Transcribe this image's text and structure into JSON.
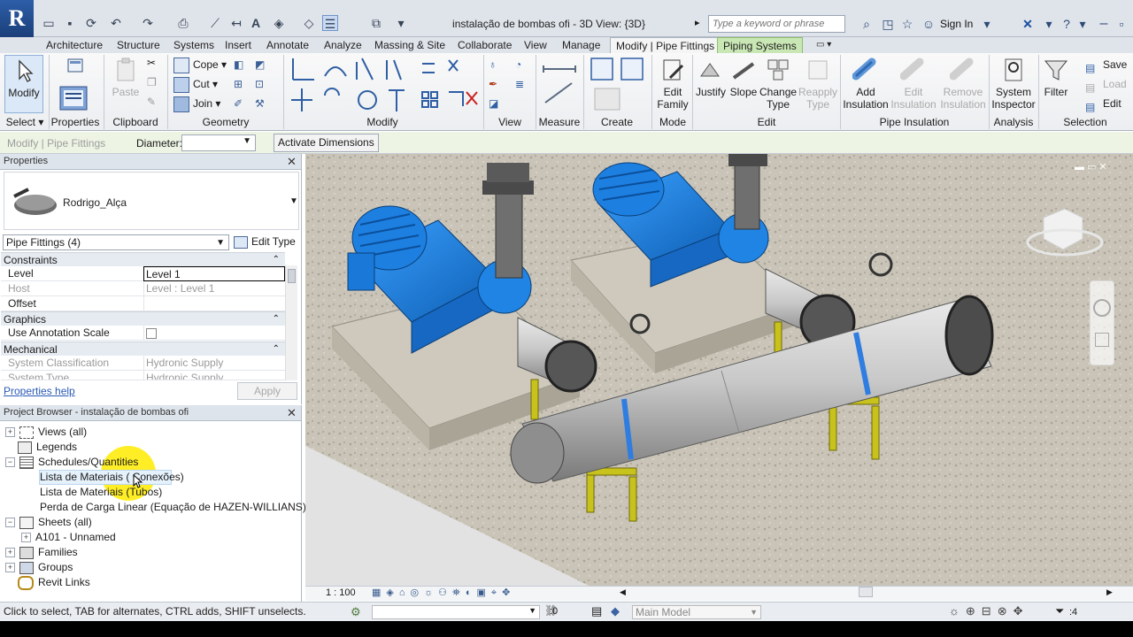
{
  "window": {
    "title": "instalação de bombas ofi - 3D View: {3D}",
    "search_placeholder": "Type a keyword or phrase",
    "sign_in": "Sign In",
    "app_logo": "R"
  },
  "ribbon_tabs": [
    "Architecture",
    "Structure",
    "Systems",
    "Insert",
    "Annotate",
    "Analyze",
    "Massing & Site",
    "Collaborate",
    "View",
    "Manage",
    "Modify | Pipe Fittings",
    "Piping Systems"
  ],
  "ribbon": {
    "select": {
      "modify_label": "Modify",
      "panel": "Select ▾"
    },
    "properties": {
      "panel": "Properties"
    },
    "clipboard": {
      "paste": "Paste",
      "panel": "Clipboard"
    },
    "geometry": {
      "cope": "Cope",
      "cut": "Cut",
      "join": "Join",
      "panel": "Geometry"
    },
    "modify": {
      "panel": "Modify"
    },
    "view": {
      "panel": "View"
    },
    "measure": {
      "panel": "Measure"
    },
    "create": {
      "panel": "Create"
    },
    "mode": {
      "edit_family": "Edit Family",
      "panel": "Mode"
    },
    "edit": {
      "justify": "Justify",
      "slope": "Slope",
      "change_type": "Change Type",
      "reapply_type": "Reapply Type",
      "panel": "Edit"
    },
    "pipe_insulation": {
      "add": "Add Insulation",
      "edit": "Edit Insulation",
      "remove": "Remove Insulation",
      "panel": "Pipe Insulation"
    },
    "analysis": {
      "system_inspector": "System Inspector",
      "panel": "Analysis"
    },
    "selection": {
      "filter": "Filter",
      "save": "Save",
      "load": "Load",
      "edit": "Edit",
      "panel": "Selection"
    }
  },
  "options_bar": {
    "context": "Modify | Pipe Fittings",
    "diameter_label": "Diameter:",
    "activate_dimensions": "Activate Dimensions"
  },
  "properties": {
    "title": "Properties",
    "type_name": "Rodrigo_Alça",
    "filter": "Pipe Fittings (4)",
    "edit_type": "Edit Type",
    "groups": {
      "constraints": "Constraints",
      "graphics": "Graphics",
      "mechanical": "Mechanical"
    },
    "rows": {
      "level": {
        "k": "Level",
        "v": "Level 1"
      },
      "host": {
        "k": "Host",
        "v": "Level : Level 1"
      },
      "offset": {
        "k": "Offset",
        "v": ""
      },
      "annotation": {
        "k": "Use Annotation Scale"
      },
      "sys_class": {
        "k": "System Classification",
        "v": "Hydronic Supply"
      },
      "sys_type": {
        "k": "System Type",
        "v": "Hydronic Supply"
      }
    },
    "help": "Properties help",
    "apply": "Apply"
  },
  "browser": {
    "title": "Project Browser - instalação de bombas ofi",
    "items": {
      "views": "Views (all)",
      "legends": "Legends",
      "schedules": "Schedules/Quantities",
      "sched1": "Lista de Materiais ( Conexões)",
      "sched2": "Lista de Materiais (Tubos)",
      "sched3": "Perda de Carga Linear (Equação de HAZEN-WILLIANS)",
      "sheets": "Sheets (all)",
      "sheet1": "A101 - Unnamed",
      "families": "Families",
      "groups": "Groups",
      "links": "Revit Links"
    }
  },
  "view_control": {
    "scale": "1 : 100"
  },
  "status": {
    "text": "Click to select, TAB for alternates, CTRL adds, SHIFT unselects.",
    "selected": ":0",
    "model": "Main Model",
    "filter_count": ":4"
  },
  "colors": {
    "pump_blue": "#1e88e6",
    "pipe_grey": "#b9b9b9",
    "support_yellow": "#c8c21c",
    "context_tab": "#c9e7b4"
  }
}
